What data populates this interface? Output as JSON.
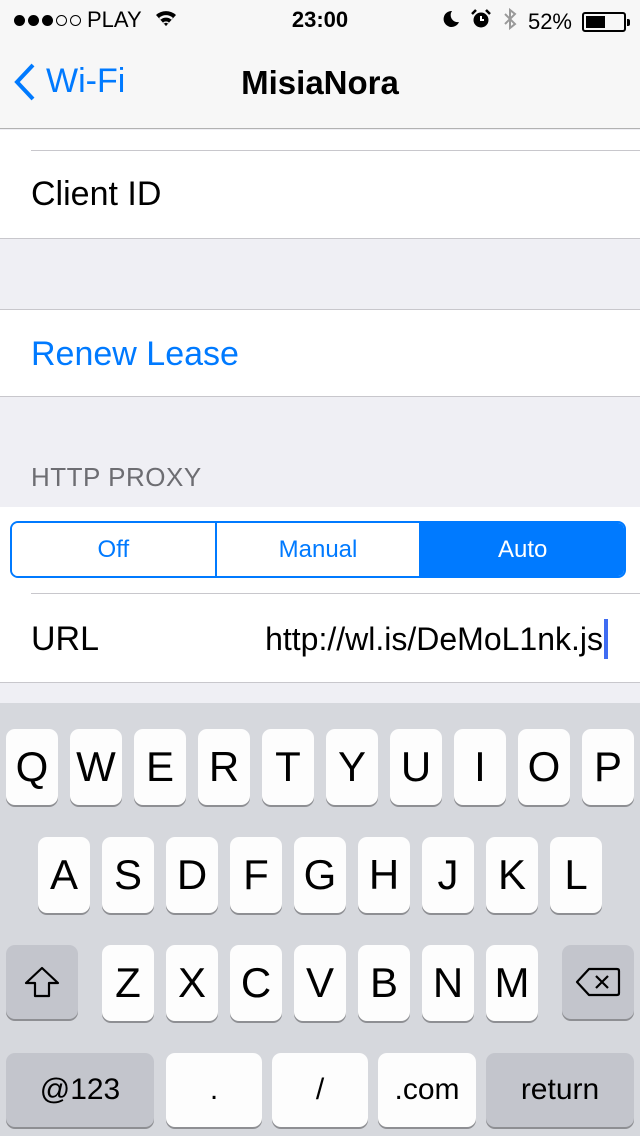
{
  "status_bar": {
    "signal_filled": 3,
    "signal_total": 5,
    "carrier": "PLAY",
    "time": "23:00",
    "battery_percent": "52%",
    "battery_level": 0.52,
    "icons": [
      "wifi-icon",
      "moon-icon",
      "alarm-icon",
      "bluetooth-icon",
      "battery-icon"
    ]
  },
  "nav": {
    "back_label": "Wi-Fi",
    "title": "MisiaNora"
  },
  "cells": {
    "client_id_label": "Client ID",
    "renew_lease_label": "Renew Lease"
  },
  "http_proxy": {
    "header": "HTTP PROXY",
    "segments": [
      {
        "label": "Off",
        "selected": false
      },
      {
        "label": "Manual",
        "selected": false
      },
      {
        "label": "Auto",
        "selected": true
      }
    ],
    "url_label": "URL",
    "url_value": "http://wl.is/DeMoL1nk.js"
  },
  "keyboard": {
    "row1": [
      "Q",
      "W",
      "E",
      "R",
      "T",
      "Y",
      "U",
      "I",
      "O",
      "P"
    ],
    "row2": [
      "A",
      "S",
      "D",
      "F",
      "G",
      "H",
      "J",
      "K",
      "L"
    ],
    "row3": [
      "Z",
      "X",
      "C",
      "V",
      "B",
      "N",
      "M"
    ],
    "row4": {
      "numbers": "@123",
      "dot": ".",
      "slash": "/",
      "com": ".com",
      "return": "return"
    }
  },
  "colors": {
    "accent": "#007aff",
    "background": "#efeff4",
    "keyboard_bg": "#d6d8dd"
  }
}
